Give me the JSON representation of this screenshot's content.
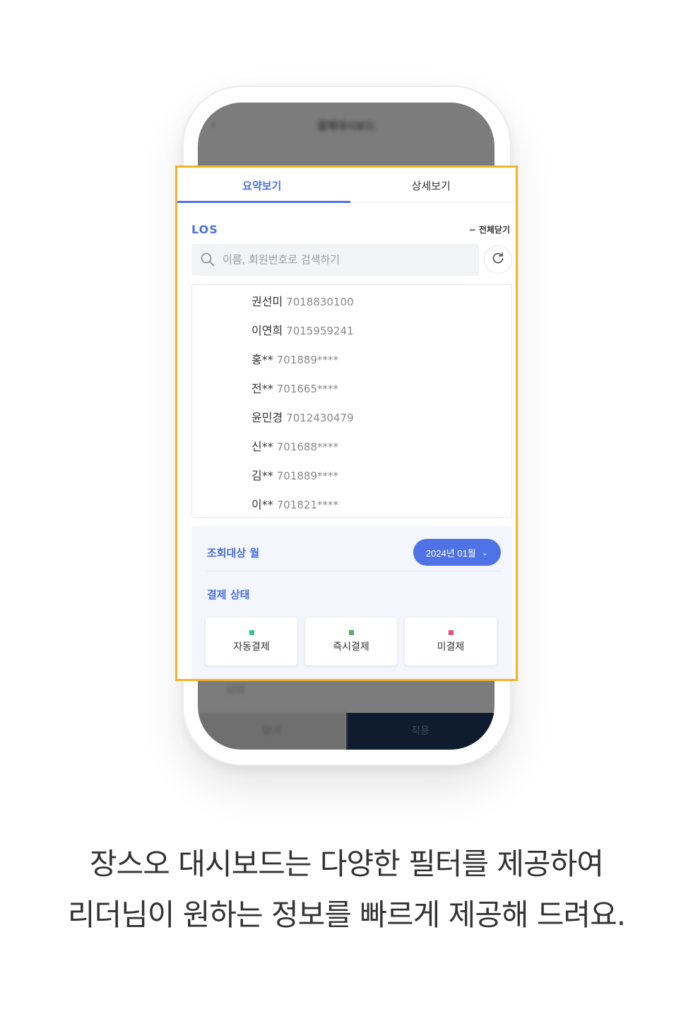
{
  "phone": {
    "screen_title": "결제대시보드",
    "bottom_row_label": "상태",
    "footer_left": "닫기",
    "footer_right": "적용"
  },
  "tabs": [
    {
      "label": "요약보기",
      "active": true
    },
    {
      "label": "상세보기",
      "active": false
    }
  ],
  "los": {
    "label": "LOS",
    "collapse_all": "− 전체닫기"
  },
  "search": {
    "placeholder": "이름, 회원번호로 검색하기",
    "icon": "search-icon",
    "refresh_icon": "refresh-icon"
  },
  "members": [
    {
      "name": "권선미",
      "id": "7018830100"
    },
    {
      "name": "이연희",
      "id": "7015959241"
    },
    {
      "name": "홍**",
      "id": "701889****"
    },
    {
      "name": "전**",
      "id": "701665****"
    },
    {
      "name": "윤민경",
      "id": "7012430479"
    },
    {
      "name": "신**",
      "id": "701688****"
    },
    {
      "name": "김**",
      "id": "701889****"
    },
    {
      "name": "이**",
      "id": "701821****"
    }
  ],
  "filter": {
    "month_label": "조회대상 월",
    "month_value": "2024년 01월",
    "status_label": "결제 상태",
    "statuses": [
      {
        "label": "자동결제",
        "color": "#3cc28a"
      },
      {
        "label": "즉시결제",
        "color": "#5aa86a"
      },
      {
        "label": "미결제",
        "color": "#e8527a"
      }
    ]
  },
  "caption": {
    "line1": "장스오 대시보드는 다양한 필터를 제공하여",
    "line2": "리더님이 원하는 정보를 빠르게 제공해 드려요."
  },
  "colors": {
    "accent": "#4f73e6",
    "highlight_border": "#f2b32d"
  }
}
